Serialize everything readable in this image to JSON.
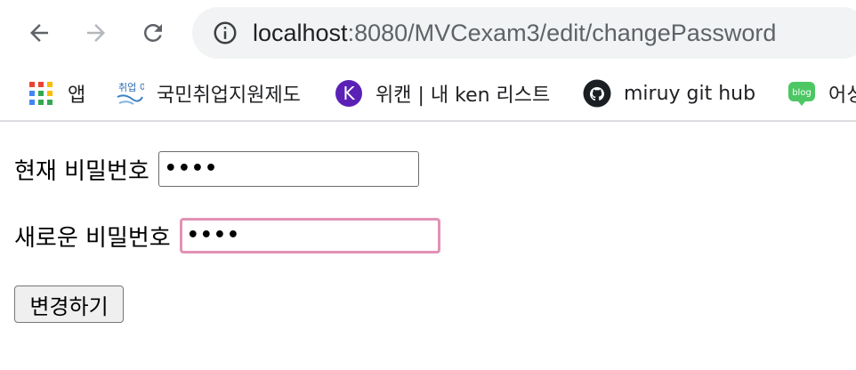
{
  "browser": {
    "url_host": "localhost",
    "url_path": ":8080/MVCexam3/edit/changePassword",
    "bookmarks": [
      {
        "label": "앱",
        "icon": "apps-grid-icon"
      },
      {
        "label": "국민취업지원제도",
        "icon": "employment-logo-icon",
        "icon_text": "취업 이룸"
      },
      {
        "label": "위캔 | 내 ken 리스트",
        "icon": "k-logo-icon",
        "icon_text": "K"
      },
      {
        "label": "miruy git hub",
        "icon": "github-icon"
      },
      {
        "label": "어싱",
        "icon": "blog-icon",
        "icon_text": "blog"
      }
    ]
  },
  "form": {
    "current_password_label": "현재 비밀번호",
    "current_password_value": "••••",
    "new_password_label": "새로운 비밀번호",
    "new_password_value": "••••",
    "submit_label": "변경하기"
  },
  "colors": {
    "focus_border": "#e291b5",
    "omnibox_bg": "#f1f3f4"
  }
}
